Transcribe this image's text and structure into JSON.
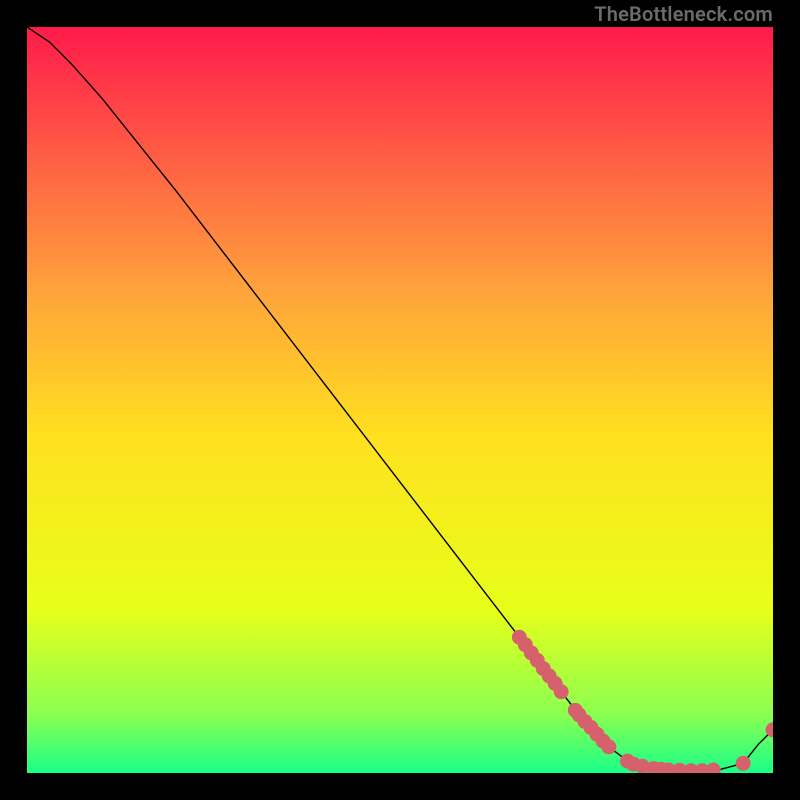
{
  "watermark": "TheBottleneck.com",
  "colors": {
    "gradient_top": "#ff1a4b",
    "gradient_q1": "#ffa23c",
    "gradient_mid": "#ffe11f",
    "gradient_q3": "#e7ff1a",
    "gradient_bot2": "#8cff4f",
    "gradient_bottom": "#1aff87",
    "page_bg": "#000000",
    "line": "#000000",
    "marker": "#d6606b"
  },
  "chart_data": {
    "type": "line",
    "title": "",
    "xlabel": "",
    "ylabel": "",
    "xlim": [
      0,
      100
    ],
    "ylim": [
      0,
      100
    ],
    "grid": false,
    "legend": false,
    "line_points": [
      {
        "x": 0.0,
        "y": 100.0
      },
      {
        "x": 3.0,
        "y": 98.0
      },
      {
        "x": 6.0,
        "y": 95.0
      },
      {
        "x": 10.0,
        "y": 90.5
      },
      {
        "x": 20.0,
        "y": 78.0
      },
      {
        "x": 30.0,
        "y": 65.0
      },
      {
        "x": 40.0,
        "y": 52.0
      },
      {
        "x": 50.0,
        "y": 39.0
      },
      {
        "x": 60.0,
        "y": 26.0
      },
      {
        "x": 66.0,
        "y": 18.2
      },
      {
        "x": 70.0,
        "y": 13.0
      },
      {
        "x": 74.0,
        "y": 7.8
      },
      {
        "x": 78.0,
        "y": 3.5
      },
      {
        "x": 80.0,
        "y": 2.0
      },
      {
        "x": 82.0,
        "y": 1.0
      },
      {
        "x": 86.0,
        "y": 0.4
      },
      {
        "x": 90.0,
        "y": 0.3
      },
      {
        "x": 93.0,
        "y": 0.5
      },
      {
        "x": 96.0,
        "y": 1.3
      },
      {
        "x": 98.0,
        "y": 3.8
      },
      {
        "x": 100.0,
        "y": 5.8
      }
    ],
    "markers": [
      {
        "x": 66.0,
        "y": 18.2
      },
      {
        "x": 66.8,
        "y": 17.2
      },
      {
        "x": 67.6,
        "y": 16.1
      },
      {
        "x": 68.4,
        "y": 15.1
      },
      {
        "x": 69.2,
        "y": 14.0
      },
      {
        "x": 70.0,
        "y": 13.0
      },
      {
        "x": 70.8,
        "y": 12.0
      },
      {
        "x": 71.6,
        "y": 10.9
      },
      {
        "x": 73.5,
        "y": 8.4
      },
      {
        "x": 74.0,
        "y": 7.8
      },
      {
        "x": 74.8,
        "y": 6.9
      },
      {
        "x": 75.6,
        "y": 6.1
      },
      {
        "x": 76.4,
        "y": 5.2
      },
      {
        "x": 77.2,
        "y": 4.3
      },
      {
        "x": 78.0,
        "y": 3.5
      },
      {
        "x": 80.5,
        "y": 1.6
      },
      {
        "x": 81.3,
        "y": 1.2
      },
      {
        "x": 82.5,
        "y": 0.9
      },
      {
        "x": 84.0,
        "y": 0.6
      },
      {
        "x": 85.0,
        "y": 0.5
      },
      {
        "x": 86.0,
        "y": 0.4
      },
      {
        "x": 87.5,
        "y": 0.35
      },
      {
        "x": 89.0,
        "y": 0.3
      },
      {
        "x": 90.5,
        "y": 0.3
      },
      {
        "x": 92.0,
        "y": 0.4
      },
      {
        "x": 96.0,
        "y": 1.3
      },
      {
        "x": 100.0,
        "y": 5.8
      }
    ],
    "marker_radius": 1.0
  }
}
